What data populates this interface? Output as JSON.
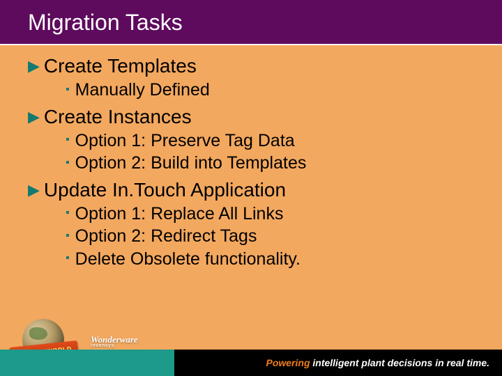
{
  "header": {
    "title": "Migration Tasks"
  },
  "topics": [
    {
      "title": "Create Templates",
      "subs": [
        "Manually Defined"
      ]
    },
    {
      "title": "Create Instances",
      "subs": [
        "Option 1: Preserve Tag Data",
        "Option 2: Build into Templates"
      ]
    },
    {
      "title": "Update In.Touch Application",
      "subs": [
        "Option 1: Replace All Links",
        "Option 2: Redirect Tags",
        "Delete Obsolete functionality."
      ]
    }
  ],
  "footer": {
    "tagline_lead": "Powering",
    "tagline_rest": " intelligent plant decisions in real time.",
    "badge_text": "WONDERWORLD",
    "brand": "Wonderware",
    "brand_sub": "invensys"
  }
}
